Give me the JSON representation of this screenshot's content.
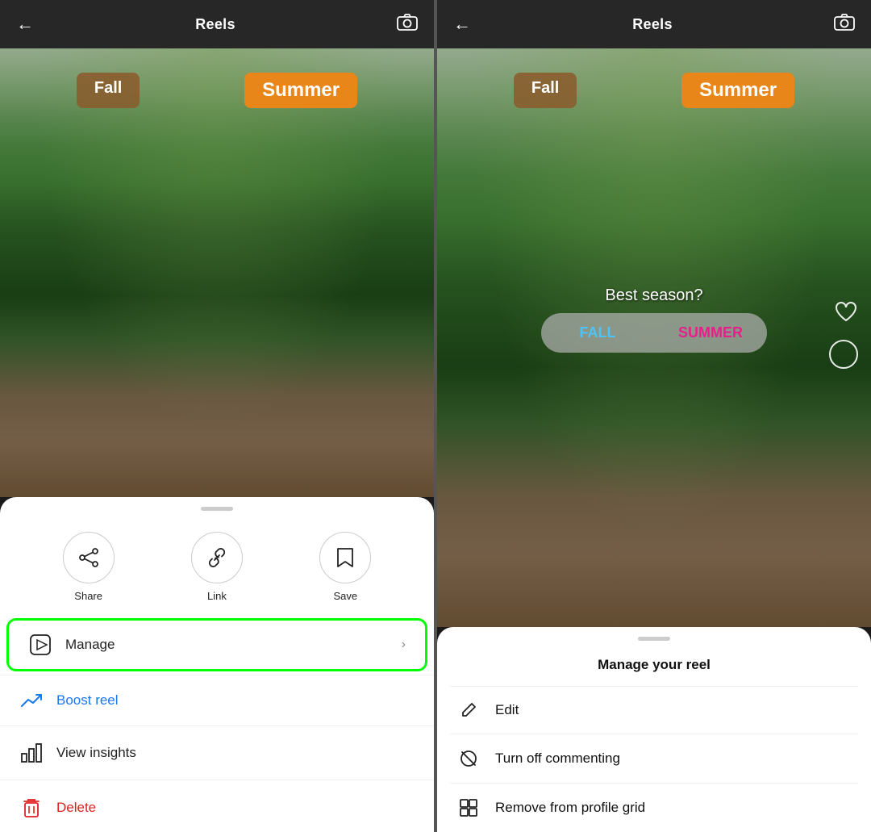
{
  "left_panel": {
    "header": {
      "back_label": "←",
      "title": "Reels",
      "camera_icon": "camera"
    },
    "image": {
      "badge_fall": "Fall",
      "badge_summer": "Summer"
    },
    "sheet": {
      "actions": [
        {
          "id": "share",
          "icon": "share",
          "label": "Share"
        },
        {
          "id": "link",
          "icon": "link",
          "label": "Link"
        },
        {
          "id": "save",
          "icon": "save",
          "label": "Save"
        }
      ],
      "menu_items": [
        {
          "id": "manage",
          "icon": "manage",
          "label": "Manage",
          "chevron": "›",
          "highlighted": true,
          "color": "normal"
        },
        {
          "id": "boost",
          "icon": "boost",
          "label": "Boost reel",
          "chevron": "",
          "highlighted": false,
          "color": "blue"
        },
        {
          "id": "insights",
          "icon": "insights",
          "label": "View insights",
          "chevron": "",
          "highlighted": false,
          "color": "normal"
        },
        {
          "id": "delete",
          "icon": "delete",
          "label": "Delete",
          "chevron": "",
          "highlighted": false,
          "color": "red"
        }
      ]
    }
  },
  "right_panel": {
    "header": {
      "back_label": "←",
      "title": "Reels",
      "camera_icon": "camera"
    },
    "image": {
      "badge_fall": "Fall",
      "badge_summer": "Summer",
      "poll_question": "Best season?",
      "poll_fall": "FALL",
      "poll_summer": "SUMMER"
    },
    "manage_sheet": {
      "title": "Manage your reel",
      "items": [
        {
          "id": "edit",
          "icon": "✏️",
          "label": "Edit"
        },
        {
          "id": "turn-off-comments",
          "icon": "🚫",
          "label": "Turn off commenting"
        },
        {
          "id": "remove-grid",
          "icon": "⊞",
          "label": "Remove from profile grid"
        }
      ]
    }
  }
}
